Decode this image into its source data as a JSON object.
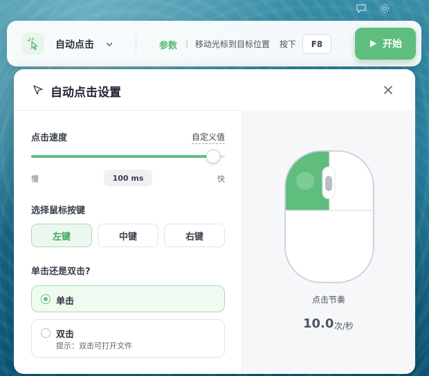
{
  "toolbar": {
    "title": "自动点击",
    "params_label": "参数",
    "separator": "|",
    "hint": "移动光标到目标位置",
    "press_label": "按下",
    "hotkey": "F8",
    "start_label": "开始"
  },
  "panel": {
    "title": "自动点击设置",
    "speed": {
      "label": "点击速度",
      "custom_label": "自定义值",
      "slow_label": "慢",
      "fast_label": "快",
      "value_label": "100 ms",
      "level": 0.94
    },
    "button_select": {
      "label": "选择鼠标按键",
      "options": [
        "左键",
        "中键",
        "右键"
      ],
      "selected": "左键"
    },
    "click_mode": {
      "label": "单击还是双击?",
      "options": [
        {
          "label": "单击",
          "hint": "",
          "selected": true
        },
        {
          "label": "双击",
          "hint": "提示：双击可打开文件",
          "selected": false
        }
      ]
    },
    "preview": {
      "rhythm_label": "点击节奏",
      "rate_value": "10.0",
      "rate_unit": "次/秒"
    }
  },
  "colors": {
    "accent": "#5fbe7d",
    "accent_light": "#ecf8ef",
    "text_dark": "#2f3440"
  },
  "icons": [
    "comment-icon",
    "gear-icon",
    "pointer-click-icon",
    "chevron-down-icon",
    "play-icon",
    "cursor-arrow-icon",
    "close-icon",
    "mouse-preview-icon"
  ]
}
